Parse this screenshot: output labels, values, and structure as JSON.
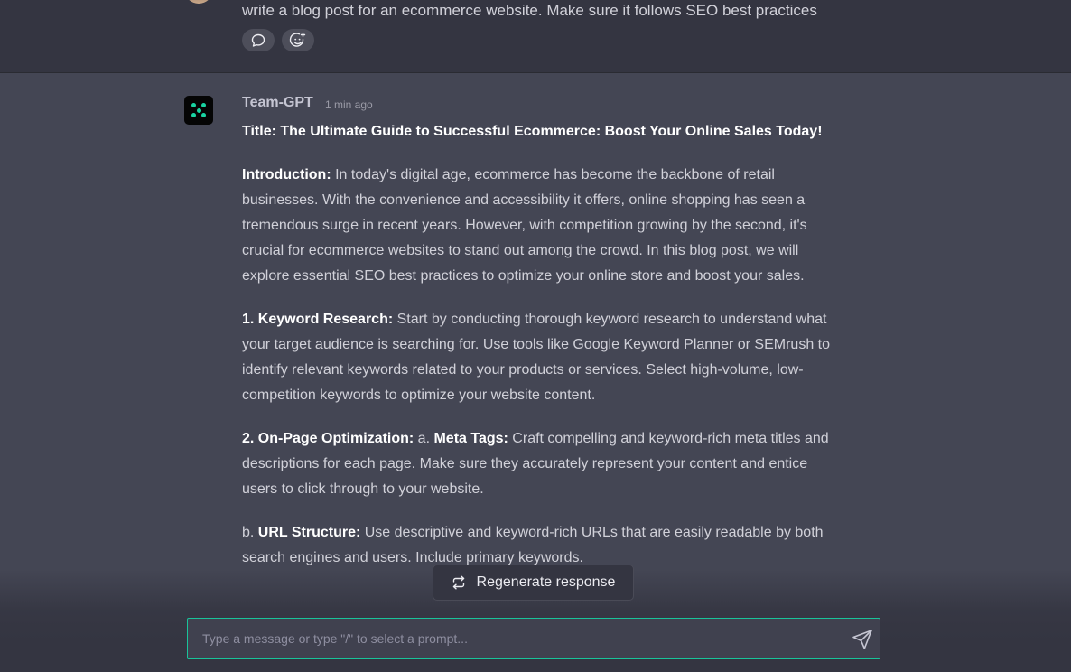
{
  "user_message": {
    "text": "write a blog post for an ecommerce website. Make sure it follows SEO best practices",
    "reactions": [
      "comment-icon",
      "add-reaction-icon"
    ]
  },
  "bot_message": {
    "name": "Team-GPT",
    "time": "1 min ago",
    "title": "Title: The Ultimate Guide to Successful Ecommerce: Boost Your Online Sales Today!",
    "intro_label": "Introduction:",
    "intro_text": " In today's digital age, ecommerce has become the backbone of retail businesses. With the convenience and accessibility it offers, online shopping has seen a tremendous surge in recent years. However, with competition growing by the second, it's crucial for ecommerce websites to stand out among the crowd. In this blog post, we will explore essential SEO best practices to optimize your online store and boost your sales.",
    "kw_label": "1. Keyword Research:",
    "kw_text": " Start by conducting thorough keyword research to understand what your target audience is searching for. Use tools like Google Keyword Planner or SEMrush to identify relevant keywords related to your products or services. Select high-volume, low-competition keywords to optimize your website content.",
    "onpage_label": "2. On-Page Optimization:",
    "onpage_mid": " a. ",
    "meta_label": "Meta Tags:",
    "meta_text": " Craft compelling and keyword-rich meta titles and descriptions for each page. Make sure they accurately represent your content and entice users to click through to your website.",
    "url_prefix": "b. ",
    "url_label": "URL Structure:",
    "url_text": " Use descriptive and keyword-rich URLs that are easily readable by both search engines and users. Include primary keywords."
  },
  "regenerate": {
    "label": "Regenerate response",
    "icon": "regenerate-icon"
  },
  "composer": {
    "placeholder": "Type a message or type \"/\" to select a prompt...",
    "send_icon": "send-icon",
    "border_color": "#19c39a"
  },
  "colors": {
    "accent": "#19d3a2",
    "bg_main": "#444654",
    "bg_user": "#343541"
  }
}
